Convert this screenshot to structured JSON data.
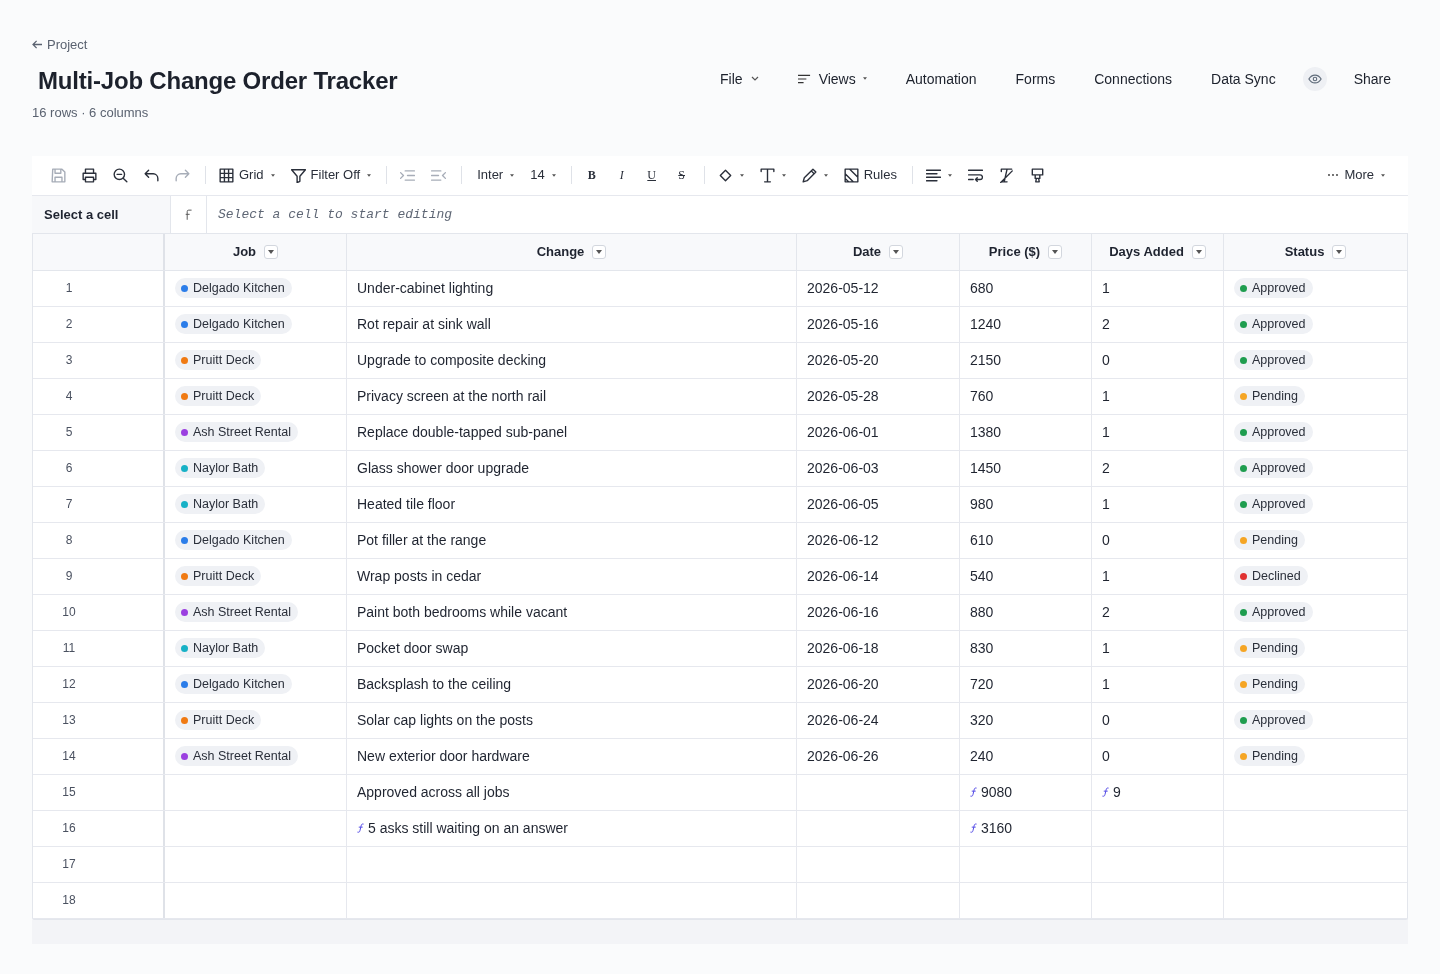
{
  "back_link": {
    "label": "Project"
  },
  "title": "Multi-Job Change Order Tracker",
  "subtitle": "16 rows · 6 columns",
  "nav": [
    {
      "kind": "menu",
      "label": "File"
    },
    {
      "kind": "views",
      "label": "Views"
    },
    {
      "kind": "link",
      "label": "Automation"
    },
    {
      "kind": "link",
      "label": "Forms"
    },
    {
      "kind": "link",
      "label": "Connections"
    },
    {
      "kind": "link",
      "label": "Data Sync"
    },
    {
      "kind": "eye"
    },
    {
      "kind": "link",
      "label": "Share"
    }
  ],
  "toolbar": {
    "groups": [
      {
        "items": [
          {
            "kind": "save",
            "disabled": true,
            "dropdown": false
          },
          {
            "kind": "print",
            "disabled": false,
            "dropdown": false
          },
          {
            "kind": "zoom",
            "disabled": false,
            "dropdown": false
          },
          {
            "kind": "undo",
            "disabled": false,
            "dropdown": false
          },
          {
            "kind": "redo",
            "disabled": true,
            "dropdown": false
          }
        ]
      },
      {
        "items": [
          {
            "kind": "grid",
            "label": "Grid",
            "disabled": false,
            "dropdown": true
          },
          {
            "kind": "filter",
            "label": "Filter Off",
            "disabled": false,
            "dropdown": true
          }
        ]
      },
      {
        "items": [
          {
            "kind": "indent",
            "disabled": true,
            "dropdown": false
          },
          {
            "kind": "outdent",
            "disabled": true,
            "dropdown": false
          }
        ]
      },
      {
        "items": [
          {
            "kind": "font",
            "label": "Inter",
            "disabled": false,
            "dropdown": true
          },
          {
            "kind": "size",
            "label": "14",
            "disabled": false,
            "dropdown": true
          }
        ]
      },
      {
        "items": [
          {
            "kind": "bold",
            "label": "B",
            "disabled": false,
            "dropdown": false
          },
          {
            "kind": "italic",
            "label": "I",
            "disabled": false,
            "dropdown": false
          },
          {
            "kind": "underline",
            "label": "U",
            "disabled": false,
            "dropdown": false
          },
          {
            "kind": "strike",
            "label": "S",
            "disabled": false,
            "dropdown": false
          }
        ]
      },
      {
        "items": [
          {
            "kind": "fill",
            "disabled": false,
            "dropdown": true
          },
          {
            "kind": "textcolor",
            "disabled": false,
            "dropdown": true
          },
          {
            "kind": "pen",
            "disabled": false,
            "dropdown": true
          },
          {
            "kind": "rules",
            "label": "Rules",
            "disabled": false,
            "dropdown": false
          }
        ]
      },
      {
        "items": [
          {
            "kind": "align",
            "disabled": false,
            "dropdown": true
          },
          {
            "kind": "wrap",
            "disabled": false,
            "dropdown": false
          },
          {
            "kind": "clear",
            "disabled": false,
            "dropdown": false
          },
          {
            "kind": "paint",
            "disabled": false,
            "dropdown": false
          }
        ]
      }
    ],
    "more": {
      "label": "More",
      "dropdown": true
    }
  },
  "formula_bar": {
    "cell_ref": "Select a cell",
    "placeholder": "Select a cell to start editing"
  },
  "table": {
    "columns": [
      {
        "label": "Job"
      },
      {
        "label": "Change"
      },
      {
        "label": "Date"
      },
      {
        "label": "Price ($)"
      },
      {
        "label": "Days Added"
      },
      {
        "label": "Status"
      }
    ],
    "rows": [
      {
        "number": "1",
        "cells": [
          {
            "kind": "tag",
            "text": "Delgado Kitchen",
            "color": "#2b7de9"
          },
          {
            "kind": "text",
            "text": "Under-cabinet lighting"
          },
          {
            "kind": "text",
            "text": "2026-05-12"
          },
          {
            "kind": "text",
            "text": "680"
          },
          {
            "kind": "text",
            "text": "1"
          },
          {
            "kind": "tag",
            "text": "Approved",
            "color": "#1f9d4f"
          }
        ]
      },
      {
        "number": "2",
        "cells": [
          {
            "kind": "tag",
            "text": "Delgado Kitchen",
            "color": "#2b7de9"
          },
          {
            "kind": "text",
            "text": "Rot repair at sink wall"
          },
          {
            "kind": "text",
            "text": "2026-05-16"
          },
          {
            "kind": "text",
            "text": "1240"
          },
          {
            "kind": "text",
            "text": "2"
          },
          {
            "kind": "tag",
            "text": "Approved",
            "color": "#1f9d4f"
          }
        ]
      },
      {
        "number": "3",
        "cells": [
          {
            "kind": "tag",
            "text": "Pruitt Deck",
            "color": "#f07a12"
          },
          {
            "kind": "text",
            "text": "Upgrade to composite decking"
          },
          {
            "kind": "text",
            "text": "2026-05-20"
          },
          {
            "kind": "text",
            "text": "2150"
          },
          {
            "kind": "text",
            "text": "0"
          },
          {
            "kind": "tag",
            "text": "Approved",
            "color": "#1f9d4f"
          }
        ]
      },
      {
        "number": "4",
        "cells": [
          {
            "kind": "tag",
            "text": "Pruitt Deck",
            "color": "#f07a12"
          },
          {
            "kind": "text",
            "text": "Privacy screen at the north rail"
          },
          {
            "kind": "text",
            "text": "2026-05-28"
          },
          {
            "kind": "text",
            "text": "760"
          },
          {
            "kind": "text",
            "text": "1"
          },
          {
            "kind": "tag",
            "text": "Pending",
            "color": "#f5a524"
          }
        ]
      },
      {
        "number": "5",
        "cells": [
          {
            "kind": "tag",
            "text": "Ash Street Rental",
            "color": "#9b40e0"
          },
          {
            "kind": "text",
            "text": "Replace double-tapped sub-panel"
          },
          {
            "kind": "text",
            "text": "2026-06-01"
          },
          {
            "kind": "text",
            "text": "1380"
          },
          {
            "kind": "text",
            "text": "1"
          },
          {
            "kind": "tag",
            "text": "Approved",
            "color": "#1f9d4f"
          }
        ]
      },
      {
        "number": "6",
        "cells": [
          {
            "kind": "tag",
            "text": "Naylor Bath",
            "color": "#17b1c6"
          },
          {
            "kind": "text",
            "text": "Glass shower door upgrade"
          },
          {
            "kind": "text",
            "text": "2026-06-03"
          },
          {
            "kind": "text",
            "text": "1450"
          },
          {
            "kind": "text",
            "text": "2"
          },
          {
            "kind": "tag",
            "text": "Approved",
            "color": "#1f9d4f"
          }
        ]
      },
      {
        "number": "7",
        "cells": [
          {
            "kind": "tag",
            "text": "Naylor Bath",
            "color": "#17b1c6"
          },
          {
            "kind": "text",
            "text": "Heated tile floor"
          },
          {
            "kind": "text",
            "text": "2026-06-05"
          },
          {
            "kind": "text",
            "text": "980"
          },
          {
            "kind": "text",
            "text": "1"
          },
          {
            "kind": "tag",
            "text": "Approved",
            "color": "#1f9d4f"
          }
        ]
      },
      {
        "number": "8",
        "cells": [
          {
            "kind": "tag",
            "text": "Delgado Kitchen",
            "color": "#2b7de9"
          },
          {
            "kind": "text",
            "text": "Pot filler at the range"
          },
          {
            "kind": "text",
            "text": "2026-06-12"
          },
          {
            "kind": "text",
            "text": "610"
          },
          {
            "kind": "text",
            "text": "0"
          },
          {
            "kind": "tag",
            "text": "Pending",
            "color": "#f5a524"
          }
        ]
      },
      {
        "number": "9",
        "cells": [
          {
            "kind": "tag",
            "text": "Pruitt Deck",
            "color": "#f07a12"
          },
          {
            "kind": "text",
            "text": "Wrap posts in cedar"
          },
          {
            "kind": "text",
            "text": "2026-06-14"
          },
          {
            "kind": "text",
            "text": "540"
          },
          {
            "kind": "text",
            "text": "1"
          },
          {
            "kind": "tag",
            "text": "Declined",
            "color": "#e03131"
          }
        ]
      },
      {
        "number": "10",
        "cells": [
          {
            "kind": "tag",
            "text": "Ash Street Rental",
            "color": "#9b40e0"
          },
          {
            "kind": "text",
            "text": "Paint both bedrooms while vacant"
          },
          {
            "kind": "text",
            "text": "2026-06-16"
          },
          {
            "kind": "text",
            "text": "880"
          },
          {
            "kind": "text",
            "text": "2"
          },
          {
            "kind": "tag",
            "text": "Approved",
            "color": "#1f9d4f"
          }
        ]
      },
      {
        "number": "11",
        "cells": [
          {
            "kind": "tag",
            "text": "Naylor Bath",
            "color": "#17b1c6"
          },
          {
            "kind": "text",
            "text": "Pocket door swap"
          },
          {
            "kind": "text",
            "text": "2026-06-18"
          },
          {
            "kind": "text",
            "text": "830"
          },
          {
            "kind": "text",
            "text": "1"
          },
          {
            "kind": "tag",
            "text": "Pending",
            "color": "#f5a524"
          }
        ]
      },
      {
        "number": "12",
        "cells": [
          {
            "kind": "tag",
            "text": "Delgado Kitchen",
            "color": "#2b7de9"
          },
          {
            "kind": "text",
            "text": "Backsplash to the ceiling"
          },
          {
            "kind": "text",
            "text": "2026-06-20"
          },
          {
            "kind": "text",
            "text": "720"
          },
          {
            "kind": "text",
            "text": "1"
          },
          {
            "kind": "tag",
            "text": "Pending",
            "color": "#f5a524"
          }
        ]
      },
      {
        "number": "13",
        "cells": [
          {
            "kind": "tag",
            "text": "Pruitt Deck",
            "color": "#f07a12"
          },
          {
            "kind": "text",
            "text": "Solar cap lights on the posts"
          },
          {
            "kind": "text",
            "text": "2026-06-24"
          },
          {
            "kind": "text",
            "text": "320"
          },
          {
            "kind": "text",
            "text": "0"
          },
          {
            "kind": "tag",
            "text": "Approved",
            "color": "#1f9d4f"
          }
        ]
      },
      {
        "number": "14",
        "cells": [
          {
            "kind": "tag",
            "text": "Ash Street Rental",
            "color": "#9b40e0"
          },
          {
            "kind": "text",
            "text": "New exterior door hardware"
          },
          {
            "kind": "text",
            "text": "2026-06-26"
          },
          {
            "kind": "text",
            "text": "240"
          },
          {
            "kind": "text",
            "text": "0"
          },
          {
            "kind": "tag",
            "text": "Pending",
            "color": "#f5a524"
          }
        ]
      },
      {
        "number": "15",
        "cells": [
          {
            "kind": "empty"
          },
          {
            "kind": "text",
            "text": "Approved across all jobs"
          },
          {
            "kind": "empty"
          },
          {
            "kind": "formula",
            "text": "9080"
          },
          {
            "kind": "formula",
            "text": "9"
          },
          {
            "kind": "empty"
          }
        ]
      },
      {
        "number": "16",
        "cells": [
          {
            "kind": "empty"
          },
          {
            "kind": "formula",
            "text": "5 asks still waiting on an answer"
          },
          {
            "kind": "empty"
          },
          {
            "kind": "formula",
            "text": "3160"
          },
          {
            "kind": "empty"
          },
          {
            "kind": "empty"
          }
        ]
      },
      {
        "number": "17",
        "cells": [
          {
            "kind": "empty"
          },
          {
            "kind": "empty"
          },
          {
            "kind": "empty"
          },
          {
            "kind": "empty"
          },
          {
            "kind": "empty"
          },
          {
            "kind": "empty"
          }
        ]
      },
      {
        "number": "18",
        "cells": [
          {
            "kind": "empty"
          },
          {
            "kind": "empty"
          },
          {
            "kind": "empty"
          },
          {
            "kind": "empty"
          },
          {
            "kind": "empty"
          },
          {
            "kind": "empty"
          }
        ]
      }
    ]
  }
}
